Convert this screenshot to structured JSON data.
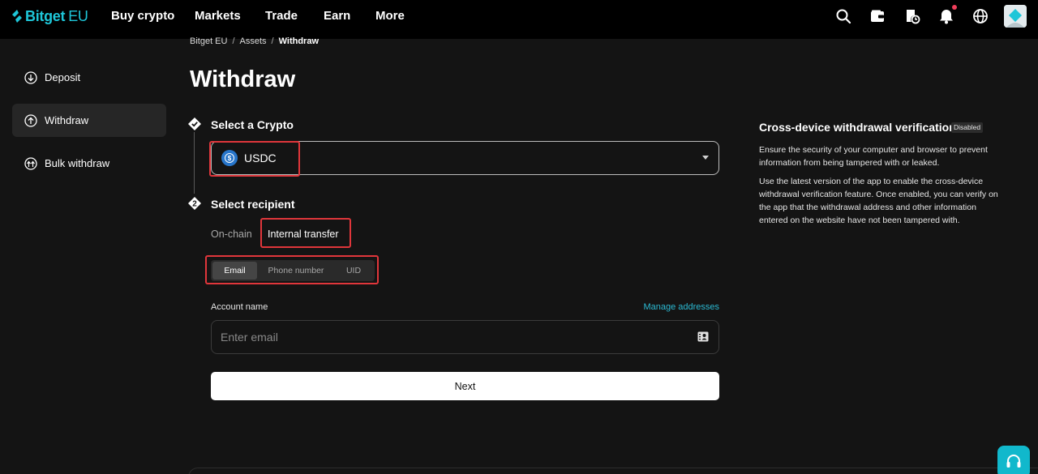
{
  "topnav": {
    "logo_text": "Bitget",
    "logo_region": "EU",
    "items": [
      "Buy crypto",
      "Markets",
      "Trade",
      "Earn",
      "More"
    ],
    "icons": [
      "search-icon",
      "wallet-icon",
      "orders-icon",
      "bell-icon",
      "globe-icon",
      "avatar"
    ]
  },
  "breadcrumb": [
    "Bitget EU",
    "Assets",
    "Withdraw"
  ],
  "sidebar": {
    "items": [
      {
        "label": "Deposit",
        "icon": "arrow-down-circle-icon"
      },
      {
        "label": "Withdraw",
        "icon": "arrow-up-circle-icon",
        "active": true
      },
      {
        "label": "Bulk withdraw",
        "icon": "double-arrow-up-circle-icon"
      }
    ]
  },
  "page": {
    "title": "Withdraw"
  },
  "steps": {
    "select_crypto": {
      "title": "Select a Crypto",
      "selected_coin": "USDC"
    },
    "select_recipient": {
      "title": "Select recipient",
      "marker": "2",
      "tabs": [
        "On-chain",
        "Internal transfer"
      ],
      "active_tab": "Internal transfer",
      "methods": [
        "Email",
        "Phone number",
        "UID"
      ],
      "active_method": "Email",
      "account_label": "Account name",
      "manage_link": "Manage addresses",
      "email_placeholder": "Enter email",
      "next_label": "Next"
    }
  },
  "info": {
    "title": "Cross-device withdrawal verification",
    "badge": "Disabled",
    "para1": "Ensure the security of your computer and browser to prevent information from being tampered with or leaked.",
    "para2": "Use the latest version of the app to enable the cross-device withdrawal verification feature. Once enabled, you can verify on the app that the withdrawal address and other information entered on the website have not been tampered with."
  },
  "colors": {
    "brand": "#1ec6d8",
    "highlight": "#e0363b",
    "usdc": "#2775ca",
    "link": "#2bb9d2"
  }
}
